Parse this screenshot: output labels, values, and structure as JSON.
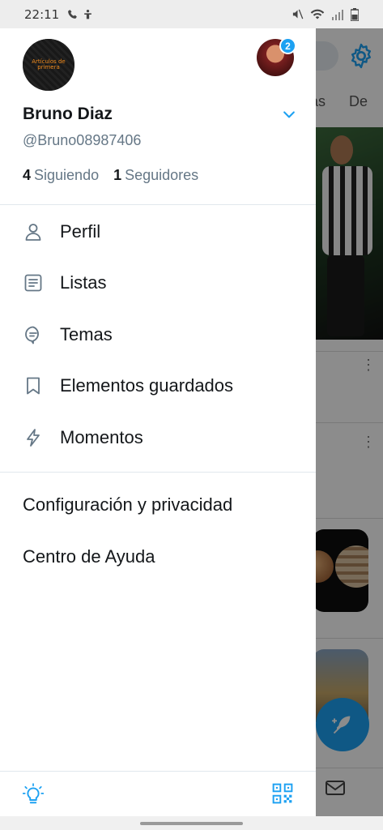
{
  "status_bar": {
    "time": "22:11"
  },
  "background": {
    "tabs": [
      "cias",
      "De"
    ]
  },
  "profile": {
    "avatar_text": "Artículos de primera",
    "display_name": "Bruno Diaz",
    "handle": "@Bruno08987406",
    "following_count": "4",
    "following_label": "Siguiendo",
    "followers_count": "1",
    "followers_label": "Seguidores",
    "notification_badge": "2"
  },
  "menu": {
    "items": [
      {
        "label": "Perfil",
        "icon": "person-icon"
      },
      {
        "label": "Listas",
        "icon": "list-icon"
      },
      {
        "label": "Temas",
        "icon": "topics-icon"
      },
      {
        "label": "Elementos guardados",
        "icon": "bookmark-icon"
      },
      {
        "label": "Momentos",
        "icon": "lightning-icon"
      }
    ],
    "secondary": [
      {
        "label": "Configuración y privacidad"
      },
      {
        "label": "Centro de Ayuda"
      }
    ]
  },
  "footer": {
    "left_icon": "lightbulb-icon",
    "right_icon": "qr-code-icon"
  },
  "colors": {
    "accent": "#1da1f2",
    "text_primary": "#14171a",
    "text_secondary": "#657786",
    "icon_gray": "#657786"
  }
}
